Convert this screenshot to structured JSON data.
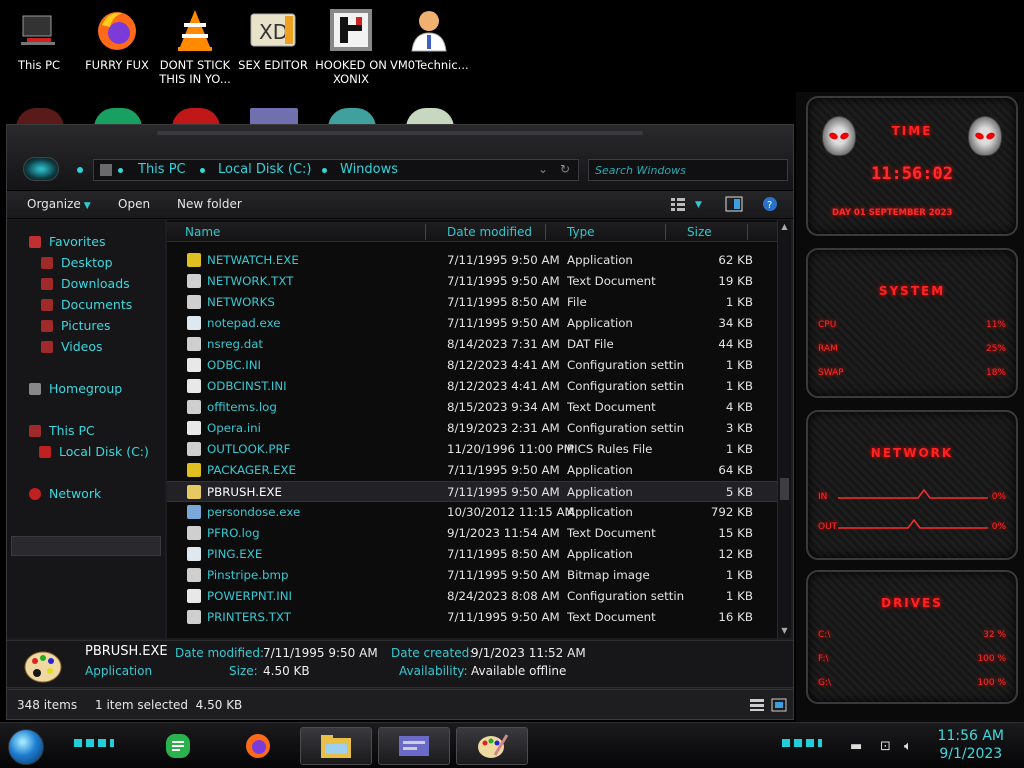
{
  "desktop_icons": [
    {
      "label": "This PC",
      "icon": "computer-icon"
    },
    {
      "label": "FURRY FUX",
      "icon": "firefox-icon"
    },
    {
      "label": "DONT STICK THIS IN YO...",
      "icon": "vlc-icon"
    },
    {
      "label": "SEX EDITOR",
      "icon": "hex-editor-icon"
    },
    {
      "label": "HOOKED ON XONIX",
      "icon": "xonix-game-icon"
    },
    {
      "label": "VM0Technic...",
      "icon": "doctor-icon"
    }
  ],
  "explorer": {
    "address": [
      "This PC",
      "Local Disk (C:)",
      "Windows"
    ],
    "search_placeholder": "Search Windows",
    "toolbar": {
      "organize": "Organize",
      "open": "Open",
      "new_folder": "New folder"
    },
    "nav": {
      "favorites": "Favorites",
      "favorites_items": [
        "Desktop",
        "Downloads",
        "Documents",
        "Pictures",
        "Videos"
      ],
      "homegroup": "Homegroup",
      "this_pc": "This PC",
      "local_disk": "Local Disk (C:)",
      "network": "Network"
    },
    "columns": {
      "name": "Name",
      "date": "Date modified",
      "type": "Type",
      "size": "Size"
    },
    "files": [
      {
        "name": "NETWATCH.EXE",
        "date": "7/11/1995 9:50 AM",
        "type": "Application",
        "size": "62 KB",
        "color": "#e0c020"
      },
      {
        "name": "NETWORK.TXT",
        "date": "7/11/1995 9:50 AM",
        "type": "Text Document",
        "size": "19 KB",
        "color": "#cfcfcf"
      },
      {
        "name": "NETWORKS",
        "date": "7/11/1995 8:50 AM",
        "type": "File",
        "size": "1 KB",
        "color": "#cfcfcf"
      },
      {
        "name": "notepad.exe",
        "date": "7/11/1995 9:50 AM",
        "type": "Application",
        "size": "34 KB",
        "color": "#dfe8ef"
      },
      {
        "name": "nsreg.dat",
        "date": "8/14/2023 7:31 AM",
        "type": "DAT File",
        "size": "44 KB",
        "color": "#cfcfcf"
      },
      {
        "name": "ODBC.INI",
        "date": "8/12/2023 4:41 AM",
        "type": "Configuration settin...",
        "size": "1 KB",
        "color": "#e8e8e8"
      },
      {
        "name": "ODBCINST.INI",
        "date": "8/12/2023 4:41 AM",
        "type": "Configuration settin...",
        "size": "1 KB",
        "color": "#e8e8e8"
      },
      {
        "name": "offitems.log",
        "date": "8/15/2023 9:34 AM",
        "type": "Text Document",
        "size": "4 KB",
        "color": "#cfcfcf"
      },
      {
        "name": "Opera.ini",
        "date": "8/19/2023 2:31 AM",
        "type": "Configuration settin...",
        "size": "3 KB",
        "color": "#e8e8e8"
      },
      {
        "name": "OUTLOOK.PRF",
        "date": "11/20/1996 11:00 PM",
        "type": "PICS Rules File",
        "size": "1 KB",
        "color": "#cfcfcf"
      },
      {
        "name": "PACKAGER.EXE",
        "date": "7/11/1995 9:50 AM",
        "type": "Application",
        "size": "64 KB",
        "color": "#e0c020"
      },
      {
        "name": "PBRUSH.EXE",
        "date": "7/11/1995 9:50 AM",
        "type": "Application",
        "size": "5 KB",
        "color": "#e8c860"
      },
      {
        "name": "persondose.exe",
        "date": "10/30/2012 11:15 AM",
        "type": "Application",
        "size": "792 KB",
        "color": "#7aa9d8"
      },
      {
        "name": "PFRO.log",
        "date": "9/1/2023 11:54 AM",
        "type": "Text Document",
        "size": "15 KB",
        "color": "#cfcfcf"
      },
      {
        "name": "PING.EXE",
        "date": "7/11/1995 8:50 AM",
        "type": "Application",
        "size": "12 KB",
        "color": "#dfe8ef"
      },
      {
        "name": "Pinstripe.bmp",
        "date": "7/11/1995 9:50 AM",
        "type": "Bitmap image",
        "size": "1 KB",
        "color": "#cfcfcf"
      },
      {
        "name": "POWERPNT.INI",
        "date": "8/24/2023 8:08 AM",
        "type": "Configuration settin...",
        "size": "1 KB",
        "color": "#e8e8e8"
      },
      {
        "name": "PRINTERS.TXT",
        "date": "7/11/1995 9:50 AM",
        "type": "Text Document",
        "size": "16 KB",
        "color": "#cfcfcf"
      }
    ],
    "selected_index": 11,
    "details": {
      "name": "PBRUSH.EXE",
      "kind": "Application",
      "date_modified_label": "Date modified:",
      "date_modified": "7/11/1995 9:50 AM",
      "size_label": "Size:",
      "size": "4.50 KB",
      "date_created_label": "Date created:",
      "date_created": "9/1/2023 11:52 AM",
      "availability_label": "Availability:",
      "availability": "Available offline"
    },
    "status": {
      "items": "348 items",
      "selected": "1 item selected  4.50 KB"
    }
  },
  "gadgets": {
    "time": {
      "title": "TIME",
      "clock": "11:56:02",
      "date": "DAY 01 SEPTEMBER 2023"
    },
    "system": {
      "title": "SYSTEM",
      "rows": [
        {
          "key": "CPU",
          "value": "11%",
          "level": 0.11
        },
        {
          "key": "RAM",
          "value": "25%",
          "level": 0.25
        },
        {
          "key": "SWAP",
          "value": "18%",
          "level": 0.18
        }
      ]
    },
    "network": {
      "title": "NETWORK",
      "rows": [
        {
          "key": "IN",
          "value": "0%"
        },
        {
          "key": "OUT",
          "value": "0%"
        }
      ]
    },
    "drives": {
      "title": "DRIVES",
      "rows": [
        {
          "key": "C:\\",
          "value": "32 %",
          "level": 0.32
        },
        {
          "key": "F:\\",
          "value": "100 %",
          "level": 1.0
        },
        {
          "key": "G:\\",
          "value": "100 %",
          "level": 1.0
        }
      ]
    }
  },
  "taskbar": {
    "clock_time": "11:56 AM",
    "clock_date": "9/1/2023",
    "tasks": [
      "feedly-icon",
      "firefox-icon",
      "file-explorer-icon",
      "control-panel-icon",
      "paint-icon"
    ]
  },
  "colors": {
    "accent": "#31c9d3",
    "gadget_red": "#ff2a2a"
  }
}
